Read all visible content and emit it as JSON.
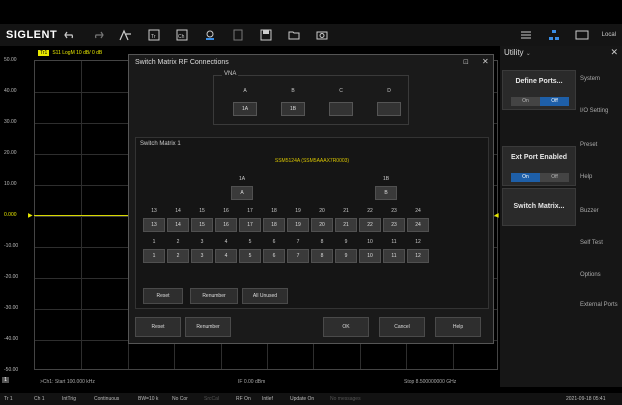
{
  "toolbar": {
    "logo": "SIGLENT",
    "local": "Local"
  },
  "trace": {
    "tag": "Tr1",
    "label": "S11 LogM 10 dB/ 0 dB",
    "color": "#e8e800"
  },
  "y_axis": [
    "50.00",
    "40.00",
    "30.00",
    "20.00",
    "10.00",
    "0.000",
    "-10.00",
    "-20.00",
    "-30.00",
    "-40.00",
    "-50.00"
  ],
  "plot_footer": {
    "channel_num": "1",
    "start": ">Ch1: Start 100.000 kHz",
    "power": "IF 0.00 dBm",
    "stop": "Stop 8.500000000 GHz"
  },
  "panel": {
    "title": "Utility",
    "define_ports": {
      "title": "Define Ports...",
      "on": "On",
      "off": "Off"
    },
    "ext_port": {
      "title": "Ext Port Enabled",
      "on": "On",
      "off": "Off"
    },
    "switch_matrix": {
      "title": "Switch Matrix..."
    },
    "side_items": [
      "System",
      "I/O Setting",
      "Preset",
      "Help",
      "Buzzer",
      "Self Test",
      "Options",
      "External Ports"
    ]
  },
  "dialog": {
    "title": "Switch Matrix RF Connections",
    "vna": {
      "title": "VNA",
      "labels": [
        "A",
        "B",
        "C",
        "D"
      ],
      "ports": [
        "1A",
        "1B",
        "",
        ""
      ]
    },
    "switch_matrix": {
      "title": "Switch Matrix 1",
      "model": "SSM5124A (SSM5AAAX7R0003)",
      "common_labels": [
        "1A",
        "1B"
      ],
      "common_values": [
        "A",
        "B"
      ],
      "row_top_labels": [
        "13",
        "14",
        "15",
        "16",
        "17",
        "18",
        "19",
        "20",
        "21",
        "22",
        "23",
        "24"
      ],
      "row_top_values": [
        "13",
        "14",
        "15",
        "16",
        "17",
        "18",
        "19",
        "20",
        "21",
        "22",
        "23",
        "24"
      ],
      "row_bottom_labels": [
        "1",
        "2",
        "3",
        "4",
        "5",
        "6",
        "7",
        "8",
        "9",
        "10",
        "11",
        "12"
      ],
      "row_bottom_values": [
        "1",
        "2",
        "3",
        "4",
        "5",
        "6",
        "7",
        "8",
        "9",
        "10",
        "11",
        "12"
      ],
      "buttons": [
        "Reset",
        "Renumber",
        "All Unused"
      ]
    },
    "buttons": {
      "reset": "Reset",
      "renumber": "Renumber",
      "ok": "OK",
      "cancel": "Cancel",
      "help": "Help"
    }
  },
  "status": [
    "Tr 1",
    "Ch 1",
    "IntTrig",
    "Continuous",
    "BW=10 k",
    "No Cor",
    "SrcCal",
    "RF On",
    "Intlef",
    "Update On",
    "No messages",
    "2021-09-18 05:41"
  ]
}
